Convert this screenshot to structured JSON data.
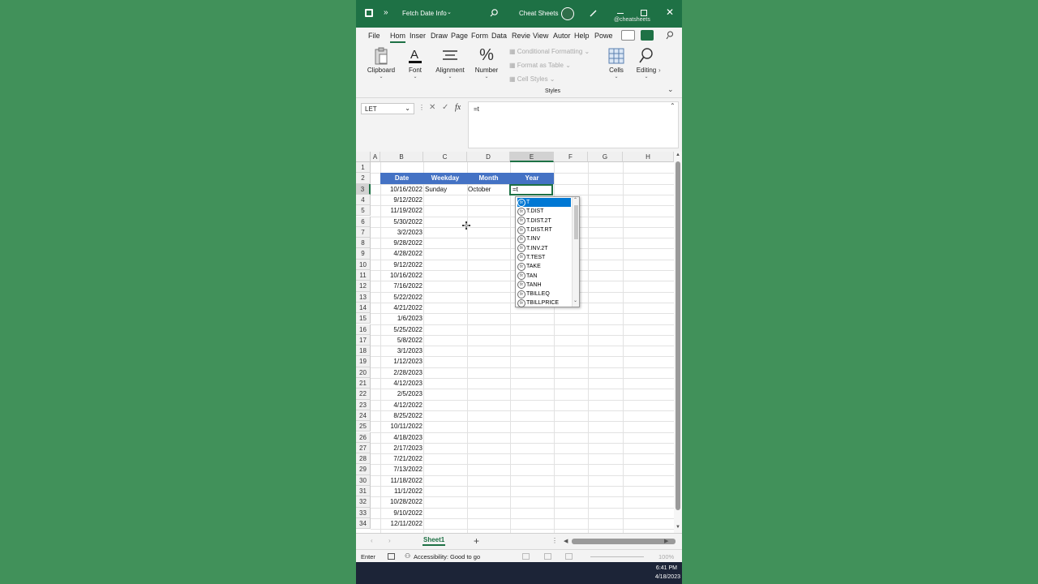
{
  "titlebar": {
    "title": "Fetch Date Info",
    "app_name": "Cheat Sheets",
    "watermark": "@cheatsheets",
    "bg": "#1e7145"
  },
  "menu": {
    "items": [
      "File",
      "Hom",
      "Inser",
      "Draw",
      "Page",
      "Form",
      "Data",
      "Revie",
      "View",
      "Autor",
      "Help",
      "Powe"
    ],
    "active": "Hom"
  },
  "ribbon": {
    "clipboard": "Clipboard",
    "font": "Font",
    "alignment": "Alignment",
    "number": "Number",
    "conditional_formatting": "Conditional Formatting",
    "format_as_table": "Format as Table",
    "cell_styles": "Cell Styles",
    "styles": "Styles",
    "cells": "Cells",
    "editing": "Editing"
  },
  "formula_bar": {
    "name_box": "LET",
    "fx": "fx",
    "formula": "=t"
  },
  "columns": [
    "A",
    "B",
    "C",
    "D",
    "E",
    "F",
    "G",
    "H"
  ],
  "rows": [
    "1",
    "2",
    "3",
    "4",
    "5",
    "6",
    "7",
    "8",
    "9",
    "10",
    "11",
    "12",
    "13",
    "14",
    "15",
    "16",
    "17",
    "18",
    "19",
    "20",
    "21",
    "22",
    "23",
    "24",
    "25",
    "26",
    "27",
    "28",
    "29",
    "30",
    "31",
    "32",
    "33",
    "34"
  ],
  "table": {
    "headers": [
      "Date",
      "Weekday",
      "Month",
      "Year"
    ],
    "first_row": {
      "weekday": "Sunday",
      "month": "October",
      "year_edit": "=t"
    },
    "dates": [
      "10/16/2022",
      "9/12/2022",
      "11/19/2022",
      "5/30/2022",
      "3/2/2023",
      "9/28/2022",
      "4/28/2022",
      "9/12/2022",
      "10/16/2022",
      "7/16/2022",
      "5/22/2022",
      "4/21/2022",
      "1/6/2023",
      "5/25/2022",
      "5/8/2022",
      "3/1/2023",
      "1/12/2023",
      "2/28/2023",
      "4/12/2023",
      "2/5/2023",
      "4/12/2022",
      "8/25/2022",
      "10/11/2022",
      "4/18/2023",
      "2/17/2023",
      "7/21/2022",
      "7/13/2022",
      "11/18/2022",
      "11/1/2022",
      "10/28/2022",
      "9/10/2022",
      "12/11/2022"
    ]
  },
  "autocomplete": {
    "items": [
      "T",
      "T.DIST",
      "T.DIST.2T",
      "T.DIST.RT",
      "T.INV",
      "T.INV.2T",
      "T.TEST",
      "TAKE",
      "TAN",
      "TANH",
      "TBILLEQ",
      "TBILLPRICE"
    ],
    "selected": "T"
  },
  "sheet_tabs": {
    "active": "Sheet1"
  },
  "status": {
    "mode": "Enter",
    "accessibility": "Accessibility: Good to go",
    "zoom": "100%"
  },
  "taskbar": {
    "time": "6:41 PM",
    "date": "4/18/2023"
  },
  "colors": {
    "header_blue": "#4472c4",
    "excel_green": "#1e7145",
    "select_blue": "#0078d4"
  }
}
